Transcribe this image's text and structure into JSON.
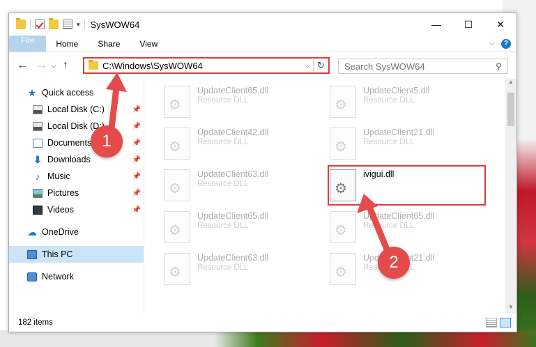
{
  "window": {
    "title": "SysWOW64",
    "controls": {
      "minimize": "—",
      "maximize": "☐",
      "close": "✕"
    }
  },
  "ribbon": {
    "tabs": [
      "File",
      "Home",
      "Share",
      "View"
    ],
    "help": "?"
  },
  "address": {
    "path": "C:\\Windows\\SysWOW64",
    "refresh": "↻",
    "dropdown": "⌵"
  },
  "search": {
    "placeholder": "Search SysWOW64",
    "icon": "search-icon"
  },
  "sidebar": {
    "quick_access": "Quick access",
    "items": [
      {
        "label": "Local Disk (C:)",
        "icon": "drive-icon",
        "pinned": true
      },
      {
        "label": "Local Disk (D:)",
        "icon": "drive-icon",
        "pinned": true
      },
      {
        "label": "Documents",
        "icon": "documents-icon",
        "pinned": true
      },
      {
        "label": "Downloads",
        "icon": "downloads-icon",
        "pinned": true
      },
      {
        "label": "Music",
        "icon": "music-icon",
        "pinned": true
      },
      {
        "label": "Pictures",
        "icon": "pictures-icon",
        "pinned": true
      },
      {
        "label": "Videos",
        "icon": "videos-icon",
        "pinned": true
      }
    ],
    "onedrive": "OneDrive",
    "this_pc": "This PC",
    "network": "Network"
  },
  "files": [
    {
      "name": "UpdateClient65.dll",
      "type": "Resource DLL"
    },
    {
      "name": "UpdateClient5.dll",
      "type": "Resource DLL"
    },
    {
      "name": "UpdateClient42.dll",
      "type": "Resource DLL"
    },
    {
      "name": "UpdateClient21.dll",
      "type": "Resource DLL"
    },
    {
      "name": "UpdateClient63.dll",
      "type": "Resource DLL"
    },
    {
      "name": "ivigui.dll",
      "type": ""
    },
    {
      "name": "UpdateClient65.dll",
      "type": "Resource DLL"
    },
    {
      "name": "UpdateClient65.dll",
      "type": "Resource DLL"
    },
    {
      "name": "UpdateClient63.dll",
      "type": "Resource DLL"
    },
    {
      "name": "UpdateClient21.dll",
      "type": "Resource DLL"
    }
  ],
  "status": {
    "count": "182 items"
  },
  "callouts": [
    "1",
    "2"
  ],
  "colors": {
    "accent": "#1979ca",
    "annotation": "#e64b4b",
    "selection": "#cce4f7"
  }
}
